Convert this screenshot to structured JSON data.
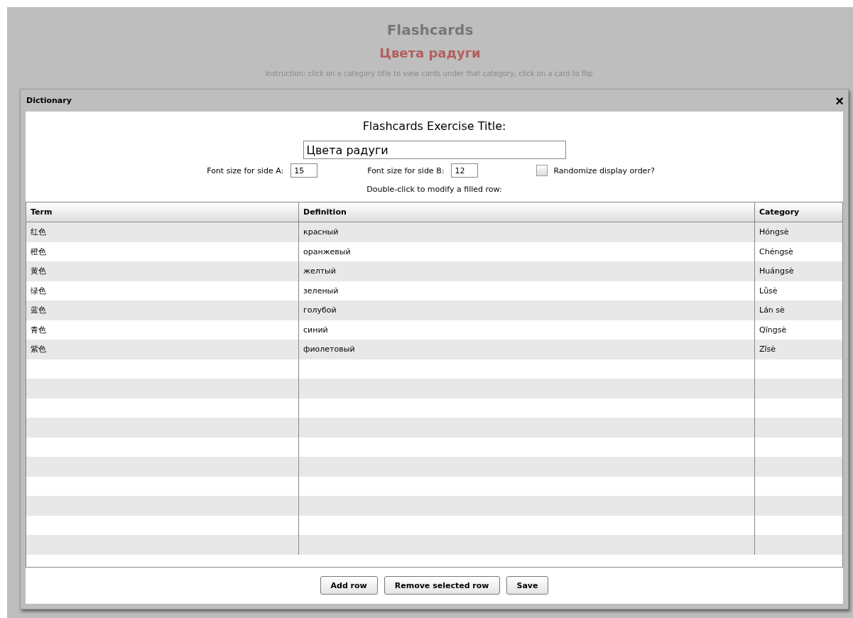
{
  "page": {
    "title": "Flashcards",
    "subtitle": "Цвета радуги",
    "instruction": "Instruction: click on a category title to view cards under that category, click on a card to flip."
  },
  "dialog": {
    "title": "Dictionary",
    "close": "×",
    "heading": "Flashcards Exercise Title:",
    "title_value": "Цвета радуги",
    "font_a_label": "Font size for side A:",
    "font_a_value": "15",
    "font_b_label": "Font size for side B:",
    "font_b_value": "12",
    "randomize": {
      "label": "Randomize display order?",
      "checked": false
    },
    "hint": "Double-click to modify a filled row:",
    "table": {
      "columns": [
        "Term",
        "Definition",
        "Category"
      ],
      "rows": [
        {
          "term": "红色",
          "definition": "красный",
          "category": "Hóngsè"
        },
        {
          "term": "橙色",
          "definition": "оранжевый",
          "category": "Chéngsè"
        },
        {
          "term": "黄色",
          "definition": "желтый",
          "category": "Huángsè"
        },
        {
          "term": "绿色",
          "definition": "зеленый",
          "category": "Lǜsè"
        },
        {
          "term": "蓝色",
          "definition": "голубой",
          "category": "Lán sè"
        },
        {
          "term": "青色",
          "definition": "синий",
          "category": "Qīngsè"
        },
        {
          "term": "紫色",
          "definition": "фиолетовый",
          "category": "Zǐsè"
        }
      ]
    },
    "buttons": [
      "Add row",
      "Remove selected row",
      "Save"
    ]
  }
}
